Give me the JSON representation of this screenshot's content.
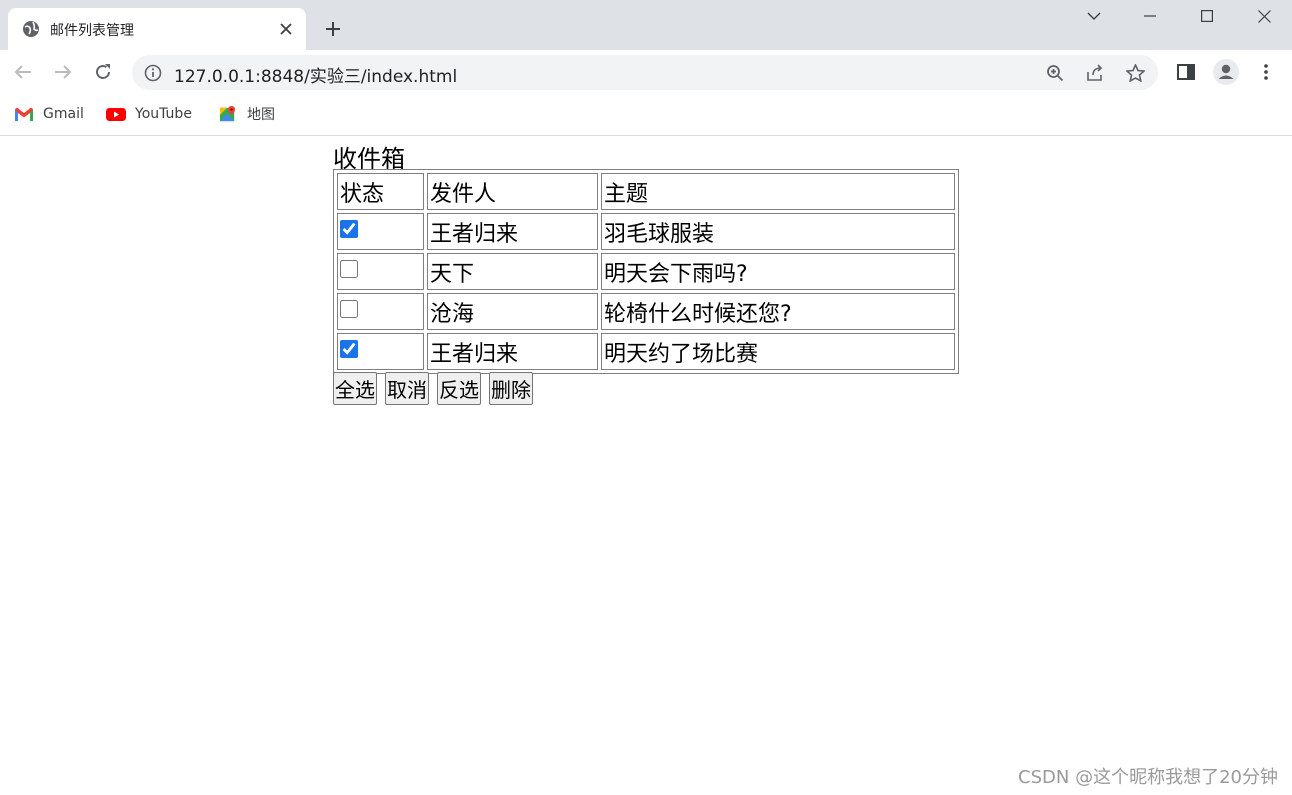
{
  "browser": {
    "tab_title": "邮件列表管理",
    "url": "127.0.0.1:8848/实验三/index.html",
    "bookmarks": [
      {
        "label": "Gmail",
        "icon": "gmail-icon"
      },
      {
        "label": "YouTube",
        "icon": "youtube-icon"
      },
      {
        "label": "地图",
        "icon": "maps-icon"
      }
    ]
  },
  "page": {
    "title": "收件箱",
    "table": {
      "headers": [
        "状态",
        "发件人",
        "主题"
      ],
      "rows": [
        {
          "checked": true,
          "sender": "王者归来",
          "subject": "羽毛球服装"
        },
        {
          "checked": false,
          "sender": "天下",
          "subject": "明天会下雨吗?"
        },
        {
          "checked": false,
          "sender": "沧海",
          "subject": "轮椅什么时候还您?"
        },
        {
          "checked": true,
          "sender": "王者归来",
          "subject": "明天约了场比赛"
        }
      ]
    },
    "buttons": {
      "select_all": "全选",
      "cancel": "取消",
      "invert": "反选",
      "delete": "删除"
    },
    "watermark": "CSDN @这个昵称我想了20分钟"
  },
  "colors": {
    "tabbar_bg": "#dee1e6",
    "omnibox_bg": "#f1f3f4",
    "checkbox_accent": "#1a73e8"
  }
}
